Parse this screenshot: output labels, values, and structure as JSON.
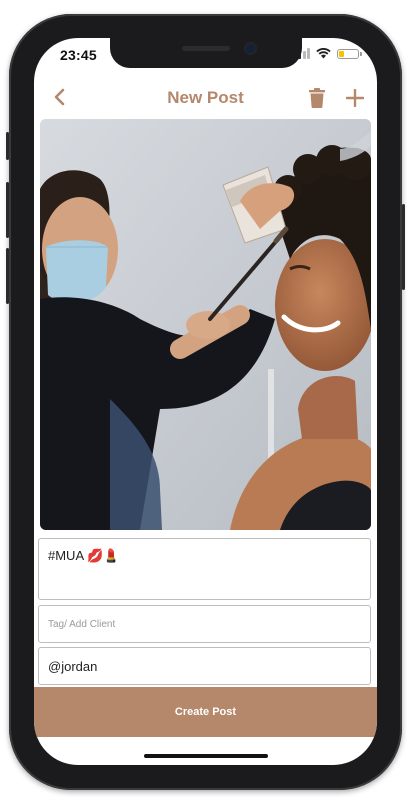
{
  "status_bar": {
    "time": "23:45",
    "battery_percent": 30
  },
  "header": {
    "title": "New Post",
    "back_icon": "chevron-left-icon",
    "delete_icon": "trash-icon",
    "add_icon": "plus-icon"
  },
  "photo": {
    "description_icon": "post-photo"
  },
  "form": {
    "caption_value": "#MUA 💋💄",
    "tag_placeholder": "Tag/ Add Client",
    "client_value": "@jordan"
  },
  "actions": {
    "create_label": "Create Post"
  },
  "colors": {
    "accent": "#b5876b",
    "background": "#ffffff",
    "field_border": "#bdbdbd"
  }
}
